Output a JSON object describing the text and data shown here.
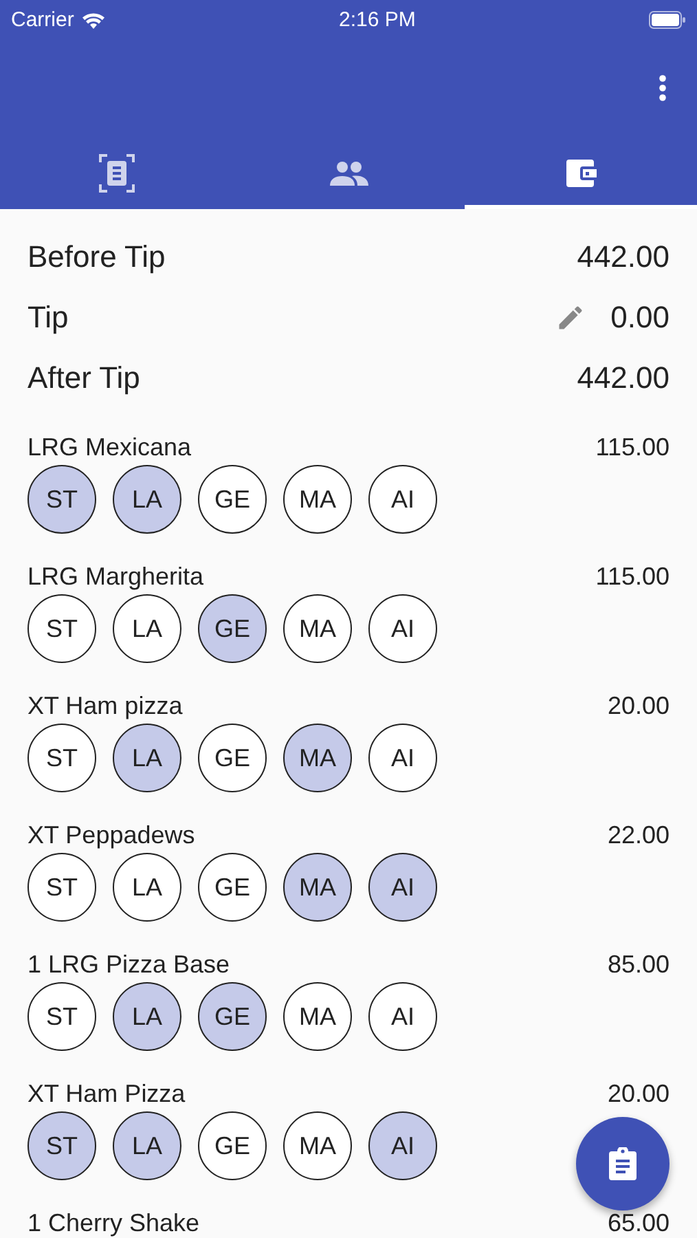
{
  "status_bar": {
    "carrier": "Carrier",
    "time": "2:16 PM"
  },
  "tabs": [
    {
      "kind": "receipt",
      "selected": false
    },
    {
      "kind": "people",
      "selected": false
    },
    {
      "kind": "wallet",
      "selected": true
    }
  ],
  "summary": [
    {
      "label": "Before Tip",
      "value": "442.00",
      "editable": false
    },
    {
      "label": "Tip",
      "value": "0.00",
      "editable": true
    },
    {
      "label": "After Tip",
      "value": "442.00",
      "editable": false
    }
  ],
  "items": [
    {
      "name": "LRG Mexicana",
      "price": "115.00",
      "people": [
        {
          "initials": "ST",
          "selected": true
        },
        {
          "initials": "LA",
          "selected": true
        },
        {
          "initials": "GE",
          "selected": false
        },
        {
          "initials": "MA",
          "selected": false
        },
        {
          "initials": "AI",
          "selected": false
        }
      ]
    },
    {
      "name": "LRG Margherita",
      "price": "115.00",
      "people": [
        {
          "initials": "ST",
          "selected": false
        },
        {
          "initials": "LA",
          "selected": false
        },
        {
          "initials": "GE",
          "selected": true
        },
        {
          "initials": "MA",
          "selected": false
        },
        {
          "initials": "AI",
          "selected": false
        }
      ]
    },
    {
      "name": "XT Ham pizza",
      "price": "20.00",
      "people": [
        {
          "initials": "ST",
          "selected": false
        },
        {
          "initials": "LA",
          "selected": true
        },
        {
          "initials": "GE",
          "selected": false
        },
        {
          "initials": "MA",
          "selected": true
        },
        {
          "initials": "AI",
          "selected": false
        }
      ]
    },
    {
      "name": "XT Peppadews",
      "price": "22.00",
      "people": [
        {
          "initials": "ST",
          "selected": false
        },
        {
          "initials": "LA",
          "selected": false
        },
        {
          "initials": "GE",
          "selected": false
        },
        {
          "initials": "MA",
          "selected": true
        },
        {
          "initials": "AI",
          "selected": true
        }
      ]
    },
    {
      "name": "1 LRG Pizza Base",
      "price": "85.00",
      "people": [
        {
          "initials": "ST",
          "selected": false
        },
        {
          "initials": "LA",
          "selected": true
        },
        {
          "initials": "GE",
          "selected": true
        },
        {
          "initials": "MA",
          "selected": false
        },
        {
          "initials": "AI",
          "selected": false
        }
      ]
    },
    {
      "name": "XT Ham Pizza",
      "price": "20.00",
      "people": [
        {
          "initials": "ST",
          "selected": true
        },
        {
          "initials": "LA",
          "selected": true
        },
        {
          "initials": "GE",
          "selected": false
        },
        {
          "initials": "MA",
          "selected": false
        },
        {
          "initials": "AI",
          "selected": true
        }
      ]
    },
    {
      "name": "1 Cherry Shake",
      "price": "65.00"
    }
  ]
}
